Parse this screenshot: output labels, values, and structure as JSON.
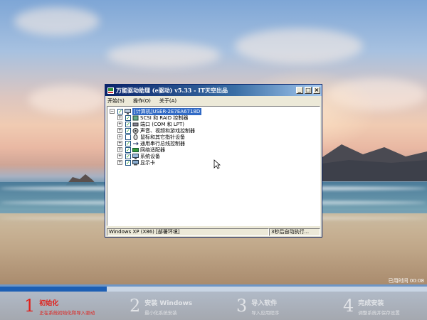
{
  "window": {
    "title": "万能驱动助理 (e驱动) v5.33 - IT天空出品",
    "buttons": {
      "minimize": "_",
      "maximize": "□",
      "close": "×"
    },
    "menu": [
      "开始(S)",
      "操作(O)",
      "关于(A)"
    ]
  },
  "tree": {
    "root": "[计算机]USER-2E7EA6718D",
    "items": [
      {
        "label": "SCSI 和 RAID 控制器",
        "checked": true,
        "icon": "scsi-controller-icon"
      },
      {
        "label": "端口 (COM 和 LPT)",
        "checked": true,
        "icon": "port-icon"
      },
      {
        "label": "声音、视频和游戏控制器",
        "checked": true,
        "icon": "sound-icon"
      },
      {
        "label": "鼠标和其它指针设备",
        "checked": false,
        "icon": "mouse-icon"
      },
      {
        "label": "通用串行总线控制器",
        "checked": true,
        "icon": "usb-icon"
      },
      {
        "label": "网络适配器",
        "checked": true,
        "icon": "network-adapter-icon"
      },
      {
        "label": "系统设备",
        "checked": true,
        "icon": "system-device-icon"
      },
      {
        "label": "显示卡",
        "checked": true,
        "icon": "display-card-icon"
      }
    ]
  },
  "status": {
    "left": "Windows XP (X86) [部署环境]",
    "right": "3秒后自动执行..."
  },
  "setup": {
    "elapsed": "已用时间 00:08",
    "progress": 0.25,
    "steps": [
      {
        "num": "1",
        "title": "初始化",
        "desc": "正在系统初始化和导入驱动",
        "active": true
      },
      {
        "num": "2",
        "title": "安装 Windows",
        "desc": "最小化系统安装",
        "active": false
      },
      {
        "num": "3",
        "title": "导入软件",
        "desc": "导入应用程序",
        "active": false
      },
      {
        "num": "4",
        "title": "完成安装",
        "desc": "调整系统并保存设置",
        "active": false
      }
    ]
  },
  "colors": {
    "accent": "#e0201b",
    "progress": "#1d5fb4",
    "titlebar": "#0a246a"
  }
}
